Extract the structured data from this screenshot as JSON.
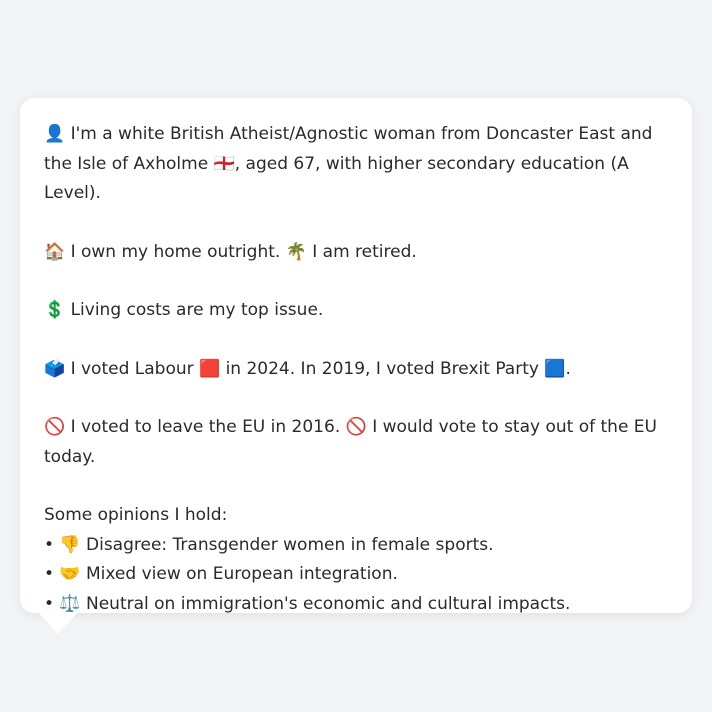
{
  "message": {
    "intro": "👤 I'm a white British Atheist/Agnostic woman from Doncaster East and the Isle of Axholme 🏴󠁧󠁢󠁥󠁮󠁧󠁿, aged 67, with higher secondary education (A Level).",
    "home": "🏠 I own my home outright. 🌴 I am retired.",
    "issue": "💲 Living costs are my top issue.",
    "vote": "🗳️ I voted Labour 🟥 in 2024. In 2019, I voted Brexit Party 🟦.",
    "eu": "🚫 I voted to leave the EU in 2016. 🚫 I would vote to stay out of the EU today.",
    "opinions_title": "Some opinions I hold:",
    "opinions": [
      "• 👎 Disagree: Transgender women in female sports.",
      "• 🤝 Mixed view on European integration.",
      "• ⚖️ Neutral on immigration's economic and cultural impacts."
    ]
  }
}
